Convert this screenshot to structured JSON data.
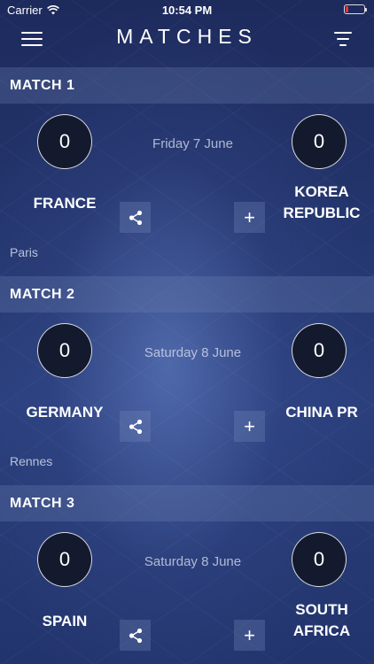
{
  "status": {
    "carrier": "Carrier",
    "time": "10:54 PM"
  },
  "header": {
    "title": "MATCHES"
  },
  "matches": [
    {
      "label": "MATCH 1",
      "home_score": "0",
      "away_score": "0",
      "date": "Friday 7 June",
      "home_team": "FRANCE",
      "away_team_line1": "KOREA",
      "away_team_line2": "REPUBLIC",
      "venue": "Paris"
    },
    {
      "label": "MATCH 2",
      "home_score": "0",
      "away_score": "0",
      "date": "Saturday 8 June",
      "home_team": "GERMANY",
      "away_team_line1": "CHINA PR",
      "away_team_line2": "",
      "venue": "Rennes"
    },
    {
      "label": "MATCH 3",
      "home_score": "0",
      "away_score": "0",
      "date": "Saturday 8 June",
      "home_team": "SPAIN",
      "away_team_line1": "SOUTH",
      "away_team_line2": "AFRICA",
      "venue": ""
    }
  ],
  "colors": {
    "background": "#24366e",
    "score_circle": "#141a2e",
    "battery_low": "#ee3333"
  },
  "icons": {
    "menu": "hamburger-icon",
    "filter": "filter-icon",
    "share": "share-icon",
    "add": "plus-icon"
  }
}
